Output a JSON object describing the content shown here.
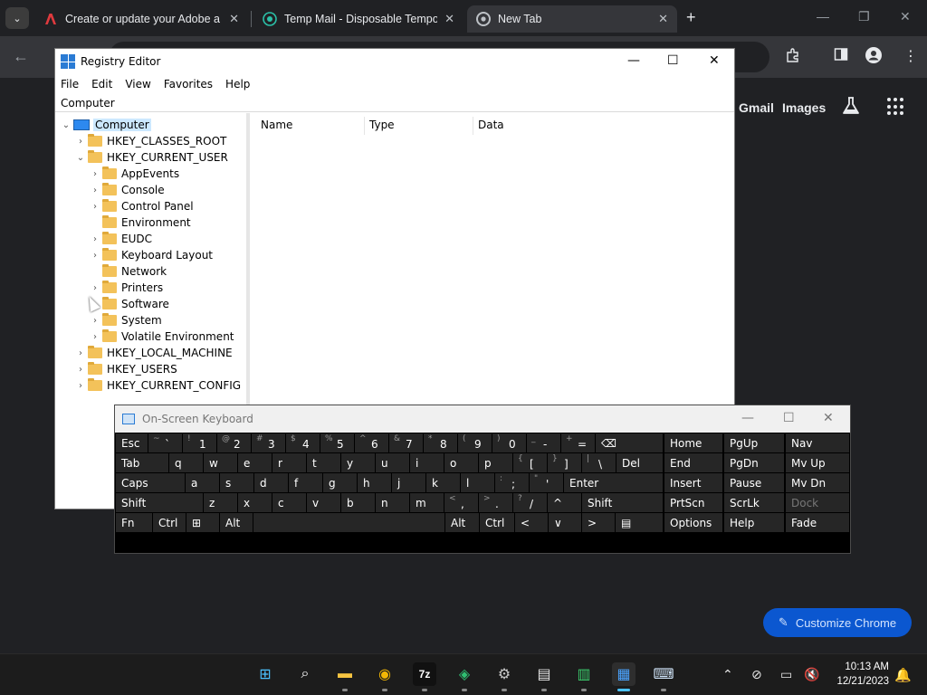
{
  "chrome": {
    "tab_search_icon": "chevron-down-icon",
    "tabs": [
      {
        "title": "Create or update your Adobe a",
        "icon": "adobe-icon",
        "favcolor": "#e03a3e"
      },
      {
        "title": "Temp Mail - Disposable Tempo",
        "icon": "tempmail-icon",
        "favcolor": "#2bc0a8"
      },
      {
        "title": "New Tab",
        "icon": "chrome-icon",
        "favcolor": "#bdc1c6"
      }
    ],
    "close_glyph": "✕",
    "new_tab_glyph": "+",
    "minimize_glyph": "—",
    "restore_glyph": "❐",
    "close_window_glyph": "✕",
    "back_glyph": "←",
    "ntp_links": [
      "Gmail",
      "Images"
    ],
    "customize_label": "Customize Chrome",
    "accent": "#0b57d0"
  },
  "regedit": {
    "title": "Registry Editor",
    "menu": [
      "File",
      "Edit",
      "View",
      "Favorites",
      "Help"
    ],
    "address": "Computer",
    "columns": [
      "Name",
      "Type",
      "Data"
    ],
    "tree": [
      {
        "label": "Computer",
        "level": 0,
        "twisty": "v",
        "type": "pc",
        "selected": true
      },
      {
        "label": "HKEY_CLASSES_ROOT",
        "level": 1,
        "twisty": ">"
      },
      {
        "label": "HKEY_CURRENT_USER",
        "level": 1,
        "twisty": "v"
      },
      {
        "label": "AppEvents",
        "level": 2,
        "twisty": ">"
      },
      {
        "label": "Console",
        "level": 2,
        "twisty": ">"
      },
      {
        "label": "Control Panel",
        "level": 2,
        "twisty": ">"
      },
      {
        "label": "Environment",
        "level": 2,
        "twisty": ""
      },
      {
        "label": "EUDC",
        "level": 2,
        "twisty": ">"
      },
      {
        "label": "Keyboard Layout",
        "level": 2,
        "twisty": ">"
      },
      {
        "label": "Network",
        "level": 2,
        "twisty": ""
      },
      {
        "label": "Printers",
        "level": 2,
        "twisty": ">"
      },
      {
        "label": "Software",
        "level": 2,
        "twisty": ">"
      },
      {
        "label": "System",
        "level": 2,
        "twisty": ">"
      },
      {
        "label": "Volatile Environment",
        "level": 2,
        "twisty": ">"
      },
      {
        "label": "HKEY_LOCAL_MACHINE",
        "level": 1,
        "twisty": ">"
      },
      {
        "label": "HKEY_USERS",
        "level": 1,
        "twisty": ">"
      },
      {
        "label": "HKEY_CURRENT_CONFIG",
        "level": 1,
        "twisty": ">"
      }
    ]
  },
  "osk": {
    "title": "On-Screen Keyboard",
    "rows": [
      [
        [
          "Esc",
          ""
        ],
        [
          "`",
          "~"
        ],
        [
          "1",
          "!"
        ],
        [
          "2",
          "@"
        ],
        [
          "3",
          "#"
        ],
        [
          "4",
          "$"
        ],
        [
          "5",
          "%"
        ],
        [
          "6",
          "^"
        ],
        [
          "7",
          "&"
        ],
        [
          "8",
          "*"
        ],
        [
          "9",
          "("
        ],
        [
          "0",
          ")"
        ],
        [
          "-",
          "_"
        ],
        [
          "=",
          "+"
        ],
        [
          "⌫",
          ""
        ],
        [
          "Home",
          ""
        ],
        [
          "PgUp",
          ""
        ],
        [
          "Nav",
          ""
        ]
      ],
      [
        [
          "Tab",
          ""
        ],
        [
          "q",
          ""
        ],
        [
          "w",
          ""
        ],
        [
          "e",
          ""
        ],
        [
          "r",
          ""
        ],
        [
          "t",
          ""
        ],
        [
          "y",
          ""
        ],
        [
          "u",
          ""
        ],
        [
          "i",
          ""
        ],
        [
          "o",
          ""
        ],
        [
          "p",
          ""
        ],
        [
          "[",
          "{"
        ],
        [
          "]",
          "}"
        ],
        [
          "\\",
          "|"
        ],
        [
          "Del",
          ""
        ],
        [
          "End",
          ""
        ],
        [
          "PgDn",
          ""
        ],
        [
          "Mv Up",
          ""
        ]
      ],
      [
        [
          "Caps",
          ""
        ],
        [
          "a",
          ""
        ],
        [
          "s",
          ""
        ],
        [
          "d",
          ""
        ],
        [
          "f",
          ""
        ],
        [
          "g",
          ""
        ],
        [
          "h",
          ""
        ],
        [
          "j",
          ""
        ],
        [
          "k",
          ""
        ],
        [
          "l",
          ""
        ],
        [
          ";",
          ":"
        ],
        [
          "'",
          "\""
        ],
        [
          "Enter",
          ""
        ],
        [
          "Insert",
          ""
        ],
        [
          "Pause",
          ""
        ],
        [
          "Mv Dn",
          ""
        ]
      ],
      [
        [
          "Shift",
          ""
        ],
        [
          "z",
          ""
        ],
        [
          "x",
          ""
        ],
        [
          "c",
          ""
        ],
        [
          "v",
          ""
        ],
        [
          "b",
          ""
        ],
        [
          "n",
          ""
        ],
        [
          "m",
          ""
        ],
        [
          ",",
          "<"
        ],
        [
          ".",
          ">"
        ],
        [
          "/",
          "?"
        ],
        [
          "^",
          ""
        ],
        [
          "Shift",
          ""
        ],
        [
          "PrtScn",
          ""
        ],
        [
          "ScrLk",
          ""
        ],
        [
          "Dock",
          ""
        ]
      ],
      [
        [
          "Fn",
          ""
        ],
        [
          "Ctrl",
          ""
        ],
        [
          "⊞",
          ""
        ],
        [
          "Alt",
          ""
        ],
        [
          "",
          ""
        ],
        [
          "Alt",
          ""
        ],
        [
          "Ctrl",
          ""
        ],
        [
          "<",
          ""
        ],
        [
          "∨",
          ""
        ],
        [
          ">",
          ""
        ],
        [
          "▤",
          ""
        ],
        [
          "Options",
          ""
        ],
        [
          "Help",
          ""
        ],
        [
          "Fade",
          ""
        ]
      ]
    ]
  },
  "taskbar": {
    "apps": [
      "start-icon",
      "search-icon",
      "file-explorer-icon",
      "chrome-icon",
      "7zip-icon",
      "photos-icon",
      "settings-icon",
      "notepad-icon",
      "task-manager-icon",
      "regedit-icon",
      "osk-icon"
    ],
    "time": "10:13 AM",
    "date": "12/21/2023"
  }
}
